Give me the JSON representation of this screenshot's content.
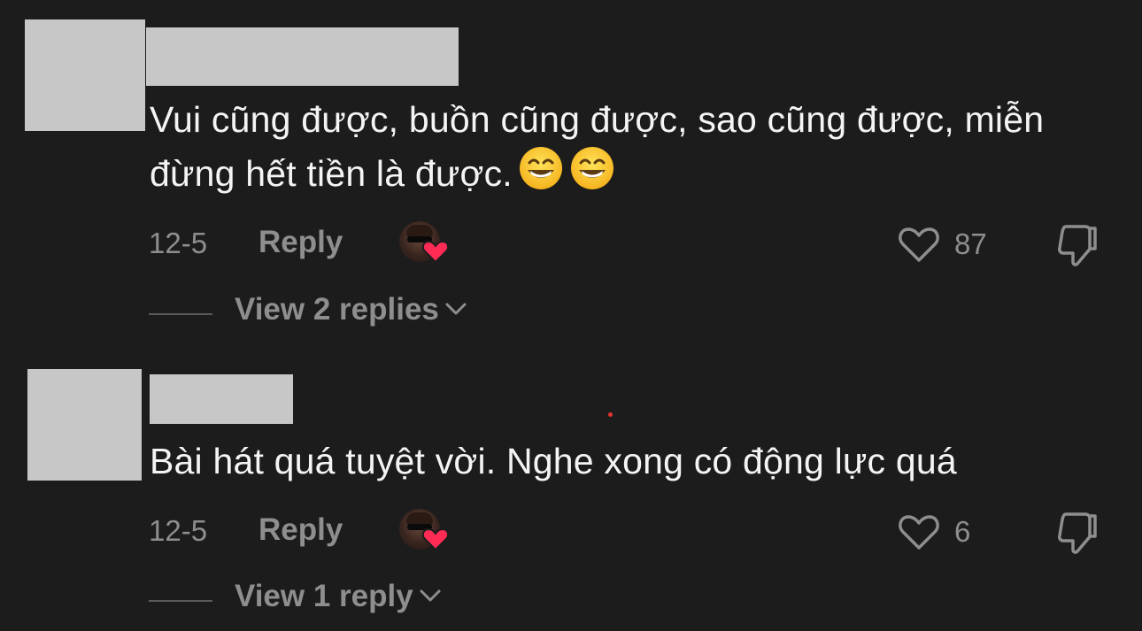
{
  "comments": [
    {
      "text": "Vui cũng được, buồn cũng được, sao cũng được, miễn đừng hết tiền là được.",
      "emojis": [
        "grinning-face-with-smiling-eyes",
        "grinning-face-with-smiling-eyes"
      ],
      "date": "12-5",
      "reply_label": "Reply",
      "like_count": "87",
      "view_replies_label": "View 2 replies",
      "liked_by_creator": true
    },
    {
      "text": "Bài hát quá tuyệt vời. Nghe xong có động lực quá",
      "emojis": [],
      "date": "12-5",
      "reply_label": "Reply",
      "like_count": "6",
      "view_replies_label": "View 1 reply",
      "liked_by_creator": true
    }
  ],
  "icons": {
    "like": "heart-outline-icon",
    "dislike": "thumbs-down-icon",
    "expand": "chevron-down-icon",
    "creator_heart": "red-heart-icon"
  },
  "colors": {
    "background": "#1c1c1c",
    "text": "#f4f4f4",
    "muted": "#8e8e8e",
    "redacted": "#c7c7c7",
    "heart": "#fe2c55"
  }
}
